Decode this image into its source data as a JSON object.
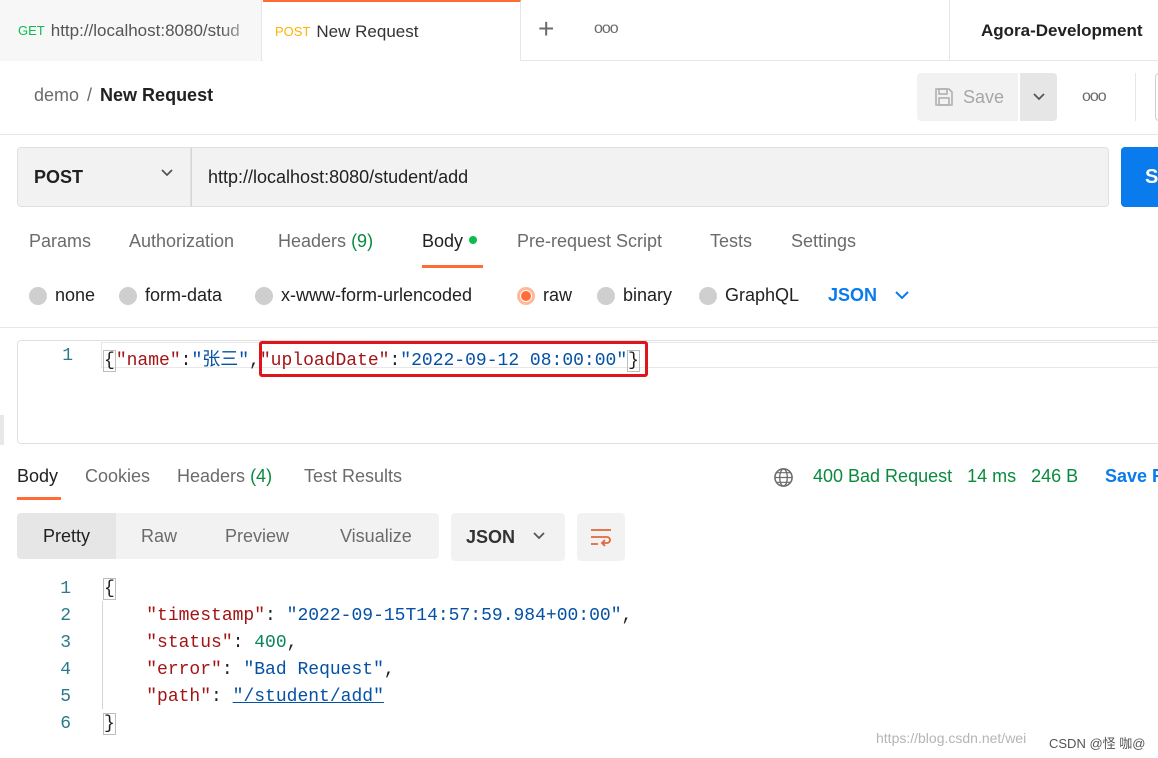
{
  "tabs": [
    {
      "method": "GET",
      "title": "http://localhost:8080/stud"
    },
    {
      "method": "POST",
      "title": "New Request"
    }
  ],
  "tabbar": {
    "new_tab": "+",
    "more": "ooo",
    "environment": "Agora-Development"
  },
  "breadcrumb": {
    "collection": "demo",
    "separator": "/",
    "request": "New Request"
  },
  "toolbar": {
    "save_label": "Save",
    "more": "ooo"
  },
  "request": {
    "method": "POST",
    "url": "http://localhost:8080/student/add",
    "send_label": "S"
  },
  "request_tabs": {
    "params": "Params",
    "authorization": "Authorization",
    "headers": "Headers",
    "headers_count": "(9)",
    "body": "Body",
    "prerequest": "Pre-request Script",
    "tests": "Tests",
    "settings": "Settings"
  },
  "body_types": {
    "none": "none",
    "form_data": "form-data",
    "urlencoded": "x-www-form-urlencoded",
    "raw": "raw",
    "binary": "binary",
    "graphql": "GraphQL",
    "format": "JSON",
    "selected": "raw"
  },
  "editor": {
    "line_number": "1",
    "open_brace": "{",
    "key1": "\"name\"",
    "colon": ":",
    "val1": "\"张三\"",
    "comma": ",",
    "key2": "\"uploadDate\"",
    "val2": "\"2022-09-12 08:00:00\"",
    "close_brace": "}"
  },
  "response_tabs": {
    "body": "Body",
    "cookies": "Cookies",
    "headers": "Headers",
    "headers_count": "(4)",
    "test_results": "Test Results"
  },
  "response_status": {
    "status": "400 Bad Request",
    "time": "14 ms",
    "size": "246 B",
    "save_label": "Save R"
  },
  "view_modes": {
    "pretty": "Pretty",
    "raw": "Raw",
    "preview": "Preview",
    "visualize": "Visualize",
    "format": "JSON"
  },
  "response_body": {
    "line_numbers": [
      "1",
      "2",
      "3",
      "4",
      "5",
      "6"
    ],
    "open_brace": "{",
    "timestamp_key": "\"timestamp\"",
    "timestamp_val": "\"2022-09-15T14:57:59.984+00:00\"",
    "status_key": "\"status\"",
    "status_val": "400",
    "error_key": "\"error\"",
    "error_val": "\"Bad Request\"",
    "path_key": "\"path\"",
    "path_val": "\"/student/add\"",
    "close_brace": "}"
  },
  "watermark": {
    "url": "https://blog.csdn.net/wei",
    "author": "CSDN @怪 咖@"
  },
  "colors": {
    "accent": "#ff6c37",
    "primary": "#097bed",
    "success": "#0a8a3e",
    "highlight_box": "#e0151c"
  }
}
